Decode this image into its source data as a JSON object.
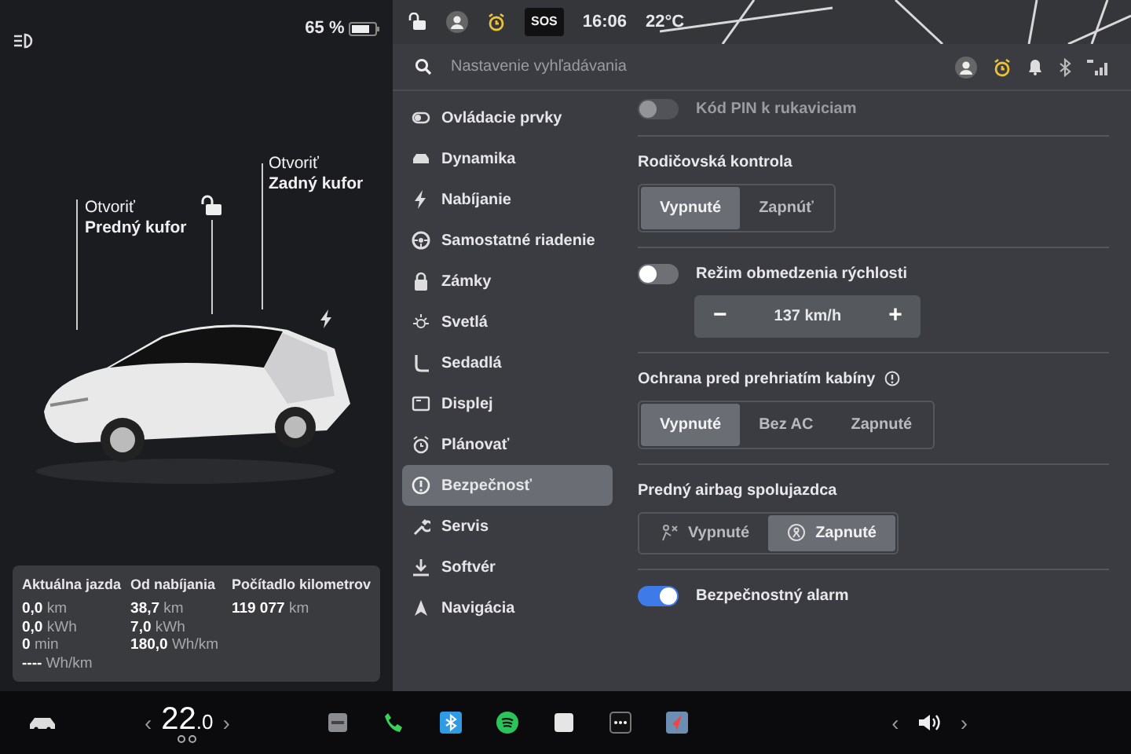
{
  "status_bar": {
    "battery": "65 %",
    "sos": "SOS",
    "time": "16:06",
    "temperature": "22°C"
  },
  "vehicle": {
    "locked": false,
    "front_trunk": {
      "action": "Otvoriť",
      "label": "Predný kufor"
    },
    "rear_trunk": {
      "action": "Otvoriť",
      "label": "Zadný kufor"
    },
    "trip_stats": [
      {
        "title": "Aktuálna jazda",
        "lines": [
          {
            "value": "0,0",
            "unit": "km"
          },
          {
            "value": "0,0",
            "unit": "kWh"
          },
          {
            "value": "0",
            "unit": "min"
          },
          {
            "value": "----",
            "unit": "Wh/km"
          }
        ]
      },
      {
        "title": "Od nabíjania",
        "lines": [
          {
            "value": "38,7",
            "unit": "km"
          },
          {
            "value": "7,0",
            "unit": "kWh"
          },
          {
            "value": "180,0",
            "unit": "Wh/km"
          }
        ]
      },
      {
        "title": "Počítadlo kilometrov",
        "lines": [
          {
            "value": "119 077",
            "unit": "km"
          }
        ]
      }
    ]
  },
  "settings": {
    "search": {
      "placeholder": "Nastavenie vyhľadávania"
    },
    "menu": [
      {
        "label": "Ovládacie prvky",
        "selected": false
      },
      {
        "label": "Dynamika",
        "selected": false
      },
      {
        "label": "Nabíjanie",
        "selected": false
      },
      {
        "label": "Samostatné riadenie",
        "selected": false
      },
      {
        "label": "Zámky",
        "selected": false
      },
      {
        "label": "Svetlá",
        "selected": false
      },
      {
        "label": "Sedadlá",
        "selected": false
      },
      {
        "label": "Displej",
        "selected": false
      },
      {
        "label": "Plánovať",
        "selected": false
      },
      {
        "label": "Bezpečnosť",
        "selected": true
      },
      {
        "label": "Servis",
        "selected": false
      },
      {
        "label": "Softvér",
        "selected": false
      },
      {
        "label": "Navigácia",
        "selected": false
      }
    ],
    "sections": [
      {
        "kind": "toggle",
        "label": "Kód PIN k rukaviciam",
        "on": false,
        "disabled": true
      },
      {
        "kind": "segmented",
        "title": "Rodičovská kontrola",
        "options": [
          {
            "label": "Vypnuté",
            "selected": true
          },
          {
            "label": "Zapnúť",
            "selected": false
          }
        ]
      },
      {
        "kind": "stepper",
        "label": "Režim obmedzenia rýchlosti",
        "on": false,
        "value": "137 km/h",
        "decrement": "−",
        "increment": "+"
      },
      {
        "kind": "segmented",
        "title": "Ochrana pred prehriatím kabíny",
        "info": true,
        "options": [
          {
            "label": "Vypnuté",
            "selected": true
          },
          {
            "label": "Bez AC",
            "selected": false
          },
          {
            "label": "Zapnuté",
            "selected": false
          }
        ]
      },
      {
        "kind": "segmented",
        "title": "Predný airbag spolujazdca",
        "with_icons": true,
        "options": [
          {
            "label": "Vypnuté",
            "selected": false
          },
          {
            "label": "Zapnuté",
            "selected": true
          }
        ]
      },
      {
        "kind": "toggle",
        "label": "Bezpečnostný alarm",
        "on": true,
        "disabled": false
      }
    ]
  },
  "dock": {
    "climate": {
      "left": "‹",
      "temperature": "22",
      "decimal": ".0",
      "right": "›"
    },
    "volume": {
      "left": "‹",
      "right": "›"
    }
  }
}
